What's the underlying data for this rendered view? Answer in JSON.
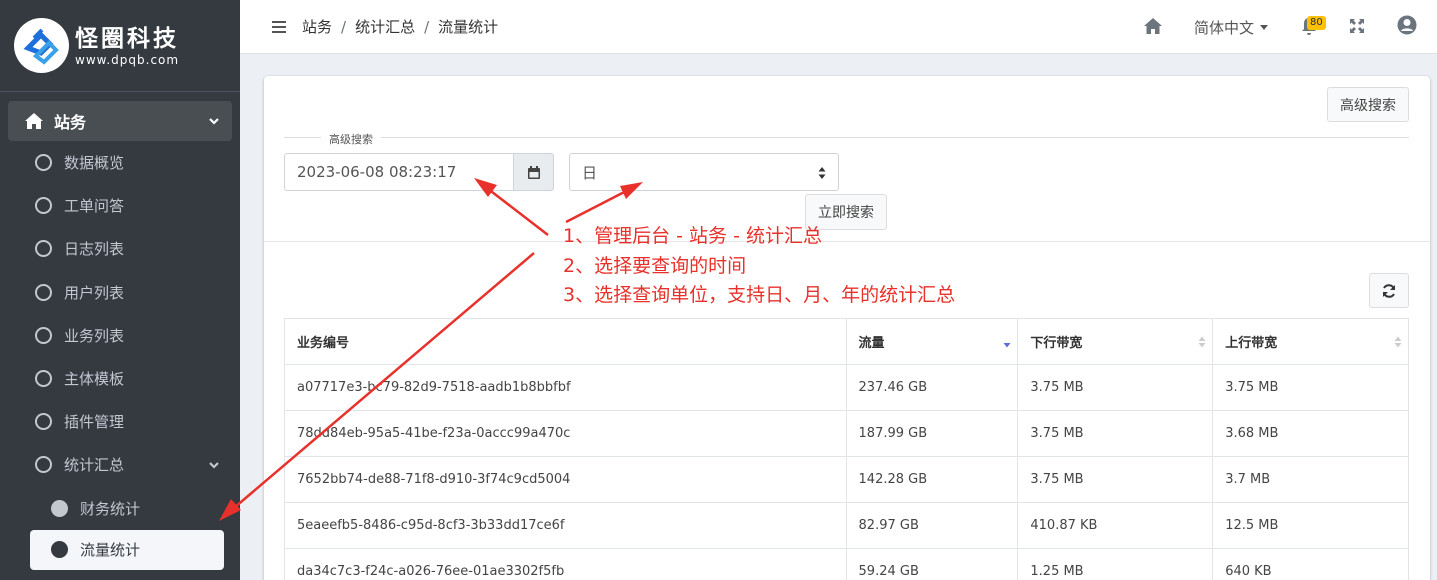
{
  "brand": {
    "name": "怪圈科技",
    "url": "www.dpqb.com"
  },
  "sidebar": {
    "top": {
      "label": "站务",
      "icon": "home-icon"
    },
    "items": [
      {
        "label": "数据概览"
      },
      {
        "label": "工单问答"
      },
      {
        "label": "日志列表"
      },
      {
        "label": "用户列表"
      },
      {
        "label": "业务列表"
      },
      {
        "label": "主体模板"
      },
      {
        "label": "插件管理"
      },
      {
        "label": "统计汇总"
      }
    ],
    "sub_items": [
      {
        "label": "财务统计"
      },
      {
        "label": "流量统计"
      }
    ]
  },
  "header": {
    "breadcrumb": [
      "站务",
      "统计汇总",
      "流量统计"
    ],
    "separator": "/",
    "language": "简体中文",
    "notification_count": "80"
  },
  "search": {
    "advanced_button": "高级搜索",
    "legend": "高级搜索",
    "datetime_value": "2023-06-08 08:23:17",
    "unit_value": "日",
    "submit_button": "立即搜索"
  },
  "table": {
    "columns": [
      "业务编号",
      "流量",
      "下行带宽",
      "上行带宽"
    ],
    "rows": [
      [
        "a07717e3-bc79-82d9-7518-aadb1b8bbfbf",
        "237.46 GB",
        "3.75 MB",
        "3.75 MB"
      ],
      [
        "78dd84eb-95a5-41be-f23a-0accc99a470c",
        "187.99 GB",
        "3.75 MB",
        "3.68 MB"
      ],
      [
        "7652bb74-de88-71f8-d910-3f74c9cd5004",
        "142.28 GB",
        "3.75 MB",
        "3.7 MB"
      ],
      [
        "5eaeefb5-8486-c95d-8cf3-3b33dd17ce6f",
        "82.97 GB",
        "410.87 KB",
        "12.5 MB"
      ],
      [
        "da34c7c3-f24c-a026-76ee-01ae3302f5fb",
        "59.24 GB",
        "1.25 MB",
        "640 KB"
      ]
    ]
  },
  "annotations": [
    "1、管理后台 - 站务 - 统计汇总",
    "2、选择要查询的时间",
    "3、选择查询单位，支持日、月、年的统计汇总"
  ],
  "colors": {
    "sidebar_bg": "#343a40",
    "annotation": "#e8312b",
    "badge": "#ffc107"
  }
}
